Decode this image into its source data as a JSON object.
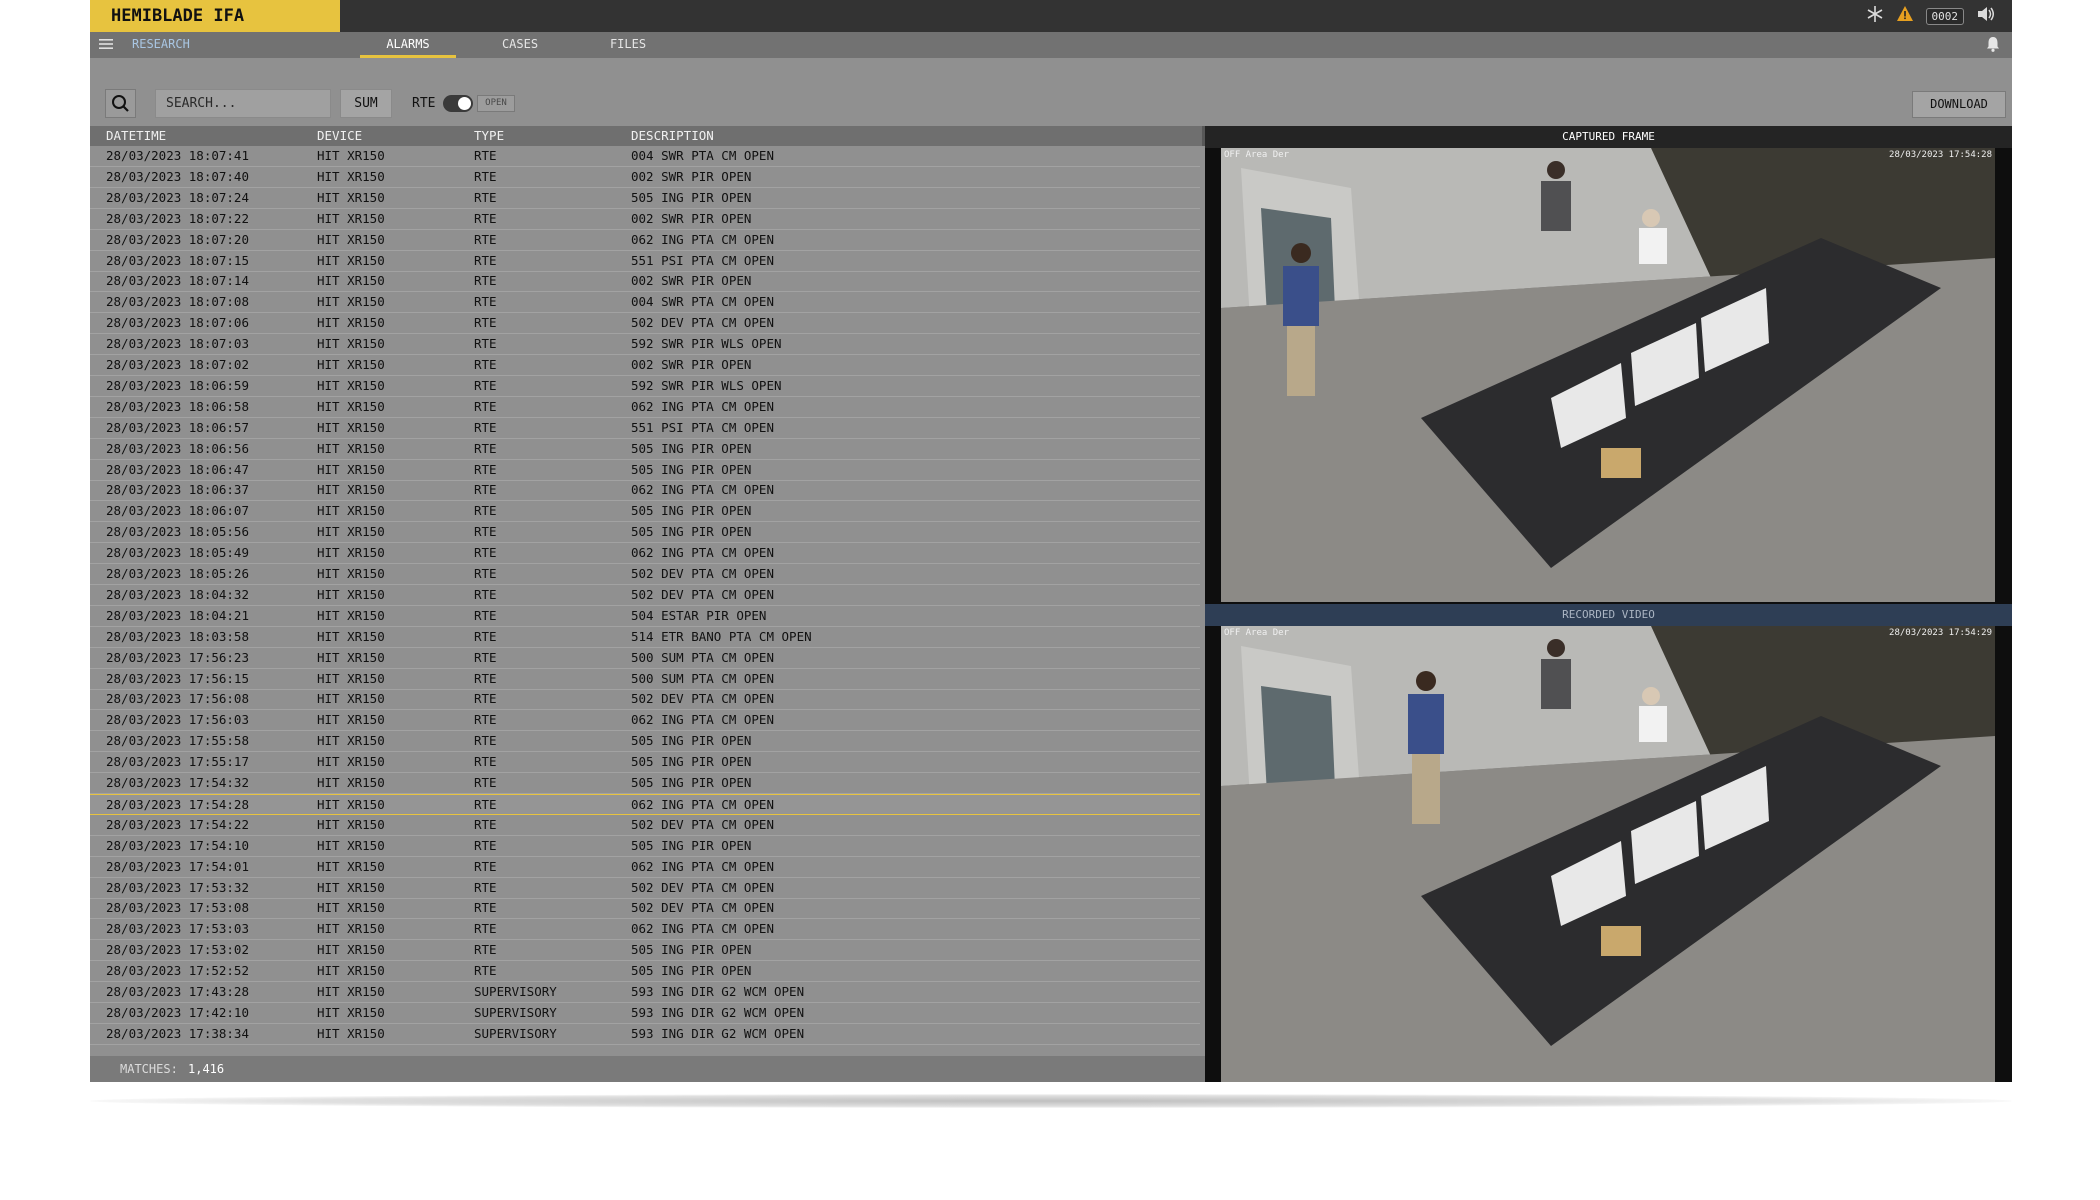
{
  "app": {
    "title": "HEMIBLADE IFA"
  },
  "status": {
    "counter": "0002"
  },
  "nav": {
    "section": "RESEARCH",
    "tabs": [
      {
        "label": "ALARMS",
        "active": true
      },
      {
        "label": "CASES",
        "active": false
      },
      {
        "label": "FILES",
        "active": false
      }
    ]
  },
  "toolbar": {
    "search_placeholder": "SEARCH...",
    "sum_label": "SUM",
    "rte_label": "RTE",
    "open_label": "OPEN",
    "download_label": "DOWNLOAD"
  },
  "table": {
    "columns": [
      "DATETIME",
      "DEVICE",
      "TYPE",
      "DESCRIPTION"
    ],
    "rows": [
      [
        "28/03/2023 18:07:41",
        "HIT XR150",
        "RTE",
        "004 SWR PTA CM OPEN"
      ],
      [
        "28/03/2023 18:07:40",
        "HIT XR150",
        "RTE",
        "002 SWR PIR OPEN"
      ],
      [
        "28/03/2023 18:07:24",
        "HIT XR150",
        "RTE",
        "505 ING PIR OPEN"
      ],
      [
        "28/03/2023 18:07:22",
        "HIT XR150",
        "RTE",
        "002 SWR PIR OPEN"
      ],
      [
        "28/03/2023 18:07:20",
        "HIT XR150",
        "RTE",
        "062 ING PTA CM OPEN"
      ],
      [
        "28/03/2023 18:07:15",
        "HIT XR150",
        "RTE",
        "551 PSI PTA CM OPEN"
      ],
      [
        "28/03/2023 18:07:14",
        "HIT XR150",
        "RTE",
        "002 SWR PIR OPEN"
      ],
      [
        "28/03/2023 18:07:08",
        "HIT XR150",
        "RTE",
        "004 SWR PTA CM OPEN"
      ],
      [
        "28/03/2023 18:07:06",
        "HIT XR150",
        "RTE",
        "502 DEV PTA CM OPEN"
      ],
      [
        "28/03/2023 18:07:03",
        "HIT XR150",
        "RTE",
        "592 SWR PIR WLS OPEN"
      ],
      [
        "28/03/2023 18:07:02",
        "HIT XR150",
        "RTE",
        "002 SWR PIR OPEN"
      ],
      [
        "28/03/2023 18:06:59",
        "HIT XR150",
        "RTE",
        "592 SWR PIR WLS OPEN"
      ],
      [
        "28/03/2023 18:06:58",
        "HIT XR150",
        "RTE",
        "062 ING PTA CM OPEN"
      ],
      [
        "28/03/2023 18:06:57",
        "HIT XR150",
        "RTE",
        "551 PSI PTA CM OPEN"
      ],
      [
        "28/03/2023 18:06:56",
        "HIT XR150",
        "RTE",
        "505 ING PIR OPEN"
      ],
      [
        "28/03/2023 18:06:47",
        "HIT XR150",
        "RTE",
        "505 ING PIR OPEN"
      ],
      [
        "28/03/2023 18:06:37",
        "HIT XR150",
        "RTE",
        "062 ING PTA CM OPEN"
      ],
      [
        "28/03/2023 18:06:07",
        "HIT XR150",
        "RTE",
        "505 ING PIR OPEN"
      ],
      [
        "28/03/2023 18:05:56",
        "HIT XR150",
        "RTE",
        "505 ING PIR OPEN"
      ],
      [
        "28/03/2023 18:05:49",
        "HIT XR150",
        "RTE",
        "062 ING PTA CM OPEN"
      ],
      [
        "28/03/2023 18:05:26",
        "HIT XR150",
        "RTE",
        "502 DEV PTA CM OPEN"
      ],
      [
        "28/03/2023 18:04:32",
        "HIT XR150",
        "RTE",
        "502 DEV PTA CM OPEN"
      ],
      [
        "28/03/2023 18:04:21",
        "HIT XR150",
        "RTE",
        "504 ESTAR PIR OPEN"
      ],
      [
        "28/03/2023 18:03:58",
        "HIT XR150",
        "RTE",
        "514 ETR BANO PTA CM OPEN"
      ],
      [
        "28/03/2023 17:56:23",
        "HIT XR150",
        "RTE",
        "500 SUM PTA CM OPEN"
      ],
      [
        "28/03/2023 17:56:15",
        "HIT XR150",
        "RTE",
        "500 SUM PTA CM OPEN"
      ],
      [
        "28/03/2023 17:56:08",
        "HIT XR150",
        "RTE",
        "502 DEV PTA CM OPEN"
      ],
      [
        "28/03/2023 17:56:03",
        "HIT XR150",
        "RTE",
        "062 ING PTA CM OPEN"
      ],
      [
        "28/03/2023 17:55:58",
        "HIT XR150",
        "RTE",
        "505 ING PIR OPEN"
      ],
      [
        "28/03/2023 17:55:17",
        "HIT XR150",
        "RTE",
        "505 ING PIR OPEN"
      ],
      [
        "28/03/2023 17:54:32",
        "HIT XR150",
        "RTE",
        "505 ING PIR OPEN"
      ],
      [
        "28/03/2023 17:54:28",
        "HIT XR150",
        "RTE",
        "062 ING PTA CM OPEN"
      ],
      [
        "28/03/2023 17:54:22",
        "HIT XR150",
        "RTE",
        "502 DEV PTA CM OPEN"
      ],
      [
        "28/03/2023 17:54:10",
        "HIT XR150",
        "RTE",
        "505 ING PIR OPEN"
      ],
      [
        "28/03/2023 17:54:01",
        "HIT XR150",
        "RTE",
        "062 ING PTA CM OPEN"
      ],
      [
        "28/03/2023 17:53:32",
        "HIT XR150",
        "RTE",
        "502 DEV PTA CM OPEN"
      ],
      [
        "28/03/2023 17:53:08",
        "HIT XR150",
        "RTE",
        "502 DEV PTA CM OPEN"
      ],
      [
        "28/03/2023 17:53:03",
        "HIT XR150",
        "RTE",
        "062 ING PTA CM OPEN"
      ],
      [
        "28/03/2023 17:53:02",
        "HIT XR150",
        "RTE",
        "505 ING PIR OPEN"
      ],
      [
        "28/03/2023 17:52:52",
        "HIT XR150",
        "RTE",
        "505 ING PIR OPEN"
      ],
      [
        "28/03/2023 17:43:28",
        "HIT XR150",
        "SUPERVISORY",
        "593 ING DIR G2 WCM OPEN"
      ],
      [
        "28/03/2023 17:42:10",
        "HIT XR150",
        "SUPERVISORY",
        "593 ING DIR G2 WCM OPEN"
      ],
      [
        "28/03/2023 17:38:34",
        "HIT XR150",
        "SUPERVISORY",
        "593 ING DIR G2 WCM OPEN"
      ]
    ],
    "selected_row": 31
  },
  "footer": {
    "matches_label": "MATCHES:",
    "matches_count": "1,416"
  },
  "video": {
    "captured_title": "CAPTURED FRAME",
    "recorded_title": "RECORDED VIDEO",
    "captured_cam_label": "OFF Area Der",
    "captured_timestamp": "28/03/2023 17:54:28",
    "recorded_cam_label": "OFF Area Der",
    "recorded_timestamp": "28/03/2023 17:54:29"
  },
  "colors": {
    "brand_yellow": "#e7c33f",
    "app_bg": "#909090",
    "topbar": "#333333",
    "nav_bg": "#727272",
    "research_blue": "#a9c6e3",
    "recorded_header": "#2e3e55"
  },
  "icons": [
    "menu-icon",
    "search-icon",
    "snowflake-icon",
    "warning-icon",
    "speaker-icon",
    "bell-icon"
  ]
}
